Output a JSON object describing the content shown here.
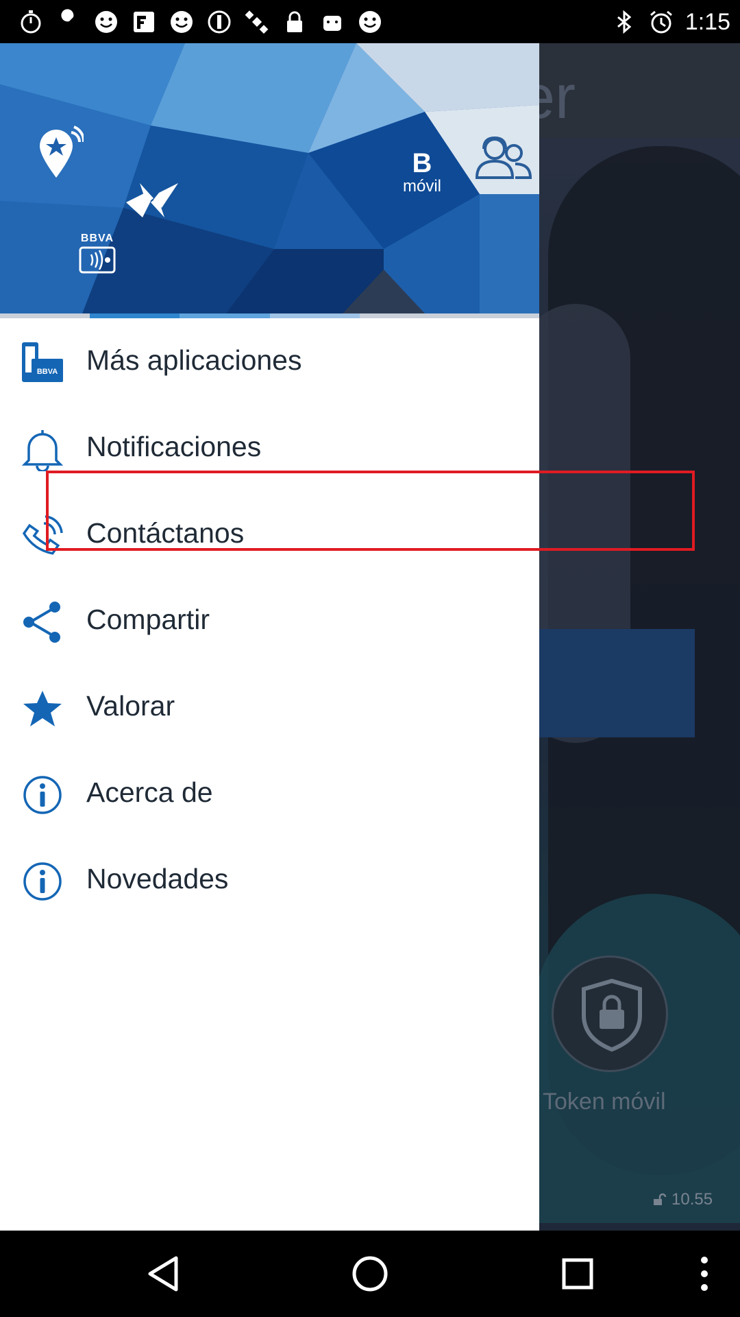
{
  "status_bar": {
    "time": "1:15",
    "left_icons": [
      "stopwatch-icon",
      "wrench-icon",
      "smiley-icon",
      "fakeapp-icon",
      "smiley-icon",
      "smiley-icon",
      "no-entry-icon",
      "fake-gps-icon",
      "lock-icon",
      "android-icon",
      "smiley-icon"
    ],
    "right_icons": [
      "bluetooth-icon",
      "alarm-icon"
    ]
  },
  "drawer": {
    "header": {
      "b_letter": "B",
      "movil_text": "móvil",
      "bbva_text": "BBVA"
    },
    "menu": [
      {
        "label": "Más aplicaciones",
        "icon": "bbva-apps-icon"
      },
      {
        "label": "Notificaciones",
        "icon": "bell-icon"
      },
      {
        "label": "Contáctanos",
        "icon": "phone-contact-icon"
      },
      {
        "label": "Compartir",
        "icon": "share-icon"
      },
      {
        "label": "Valorar",
        "icon": "star-icon"
      },
      {
        "label": "Acerca de",
        "icon": "info-icon"
      },
      {
        "label": "Novedades",
        "icon": "info-icon"
      }
    ]
  },
  "background_app": {
    "header_fragment": "er",
    "token_label": "Token móvil",
    "version": "10.55"
  },
  "colors": {
    "brand_blue": "#1d5fab",
    "icon_blue": "#1466b5",
    "highlight_red": "#e01b22"
  }
}
